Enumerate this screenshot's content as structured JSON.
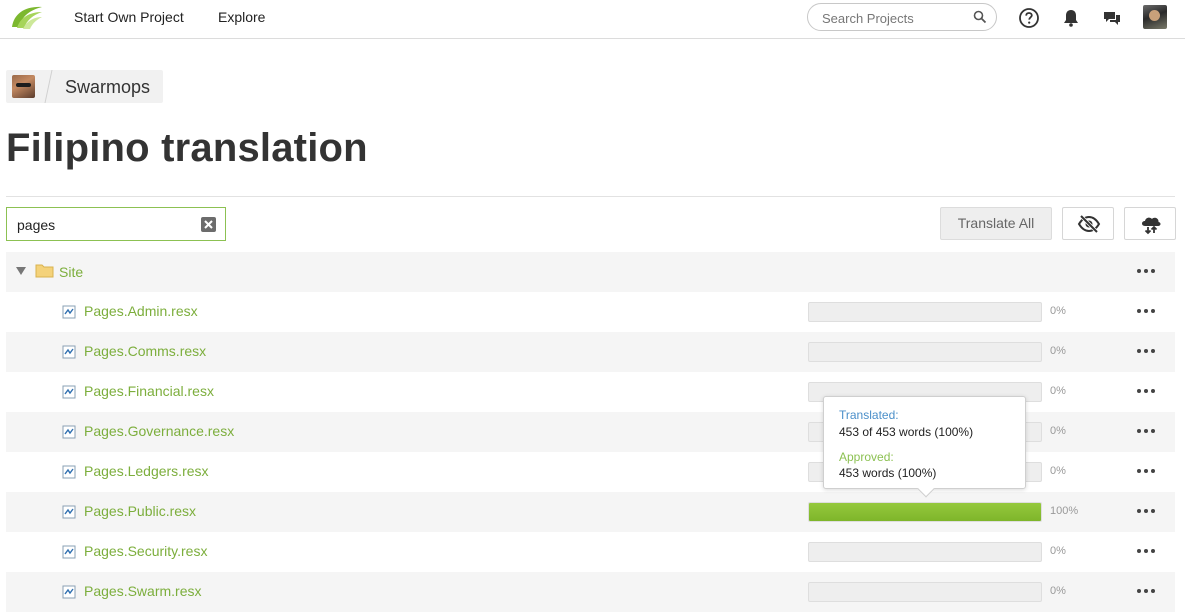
{
  "nav": {
    "start_project": "Start Own Project",
    "explore": "Explore",
    "search_placeholder": "Search Projects"
  },
  "breadcrumb": {
    "project": "Swarmops"
  },
  "page": {
    "title": "Filipino translation"
  },
  "filter": {
    "value": "pages"
  },
  "toolbar": {
    "translate_all": "Translate All"
  },
  "tree": {
    "folder": "Site",
    "files": [
      {
        "name": "Pages.Admin.resx",
        "percent_label": "0%",
        "progress": 0
      },
      {
        "name": "Pages.Comms.resx",
        "percent_label": "0%",
        "progress": 0
      },
      {
        "name": "Pages.Financial.resx",
        "percent_label": "0%",
        "progress": 0
      },
      {
        "name": "Pages.Governance.resx",
        "percent_label": "0%",
        "progress": 0
      },
      {
        "name": "Pages.Ledgers.resx",
        "percent_label": "0%",
        "progress": 0
      },
      {
        "name": "Pages.Public.resx",
        "percent_label": "100%",
        "progress": 100
      },
      {
        "name": "Pages.Security.resx",
        "percent_label": "0%",
        "progress": 0
      },
      {
        "name": "Pages.Swarm.resx",
        "percent_label": "0%",
        "progress": 0
      }
    ]
  },
  "tooltip": {
    "translated_label": "Translated:",
    "translated_value": "453 of 453 words (100%)",
    "approved_label": "Approved:",
    "approved_value": "453 words (100%)"
  },
  "colors": {
    "accent_green": "#7cae3c",
    "progress_green": "#8cc152",
    "translated_blue": "#4b8fc9"
  }
}
